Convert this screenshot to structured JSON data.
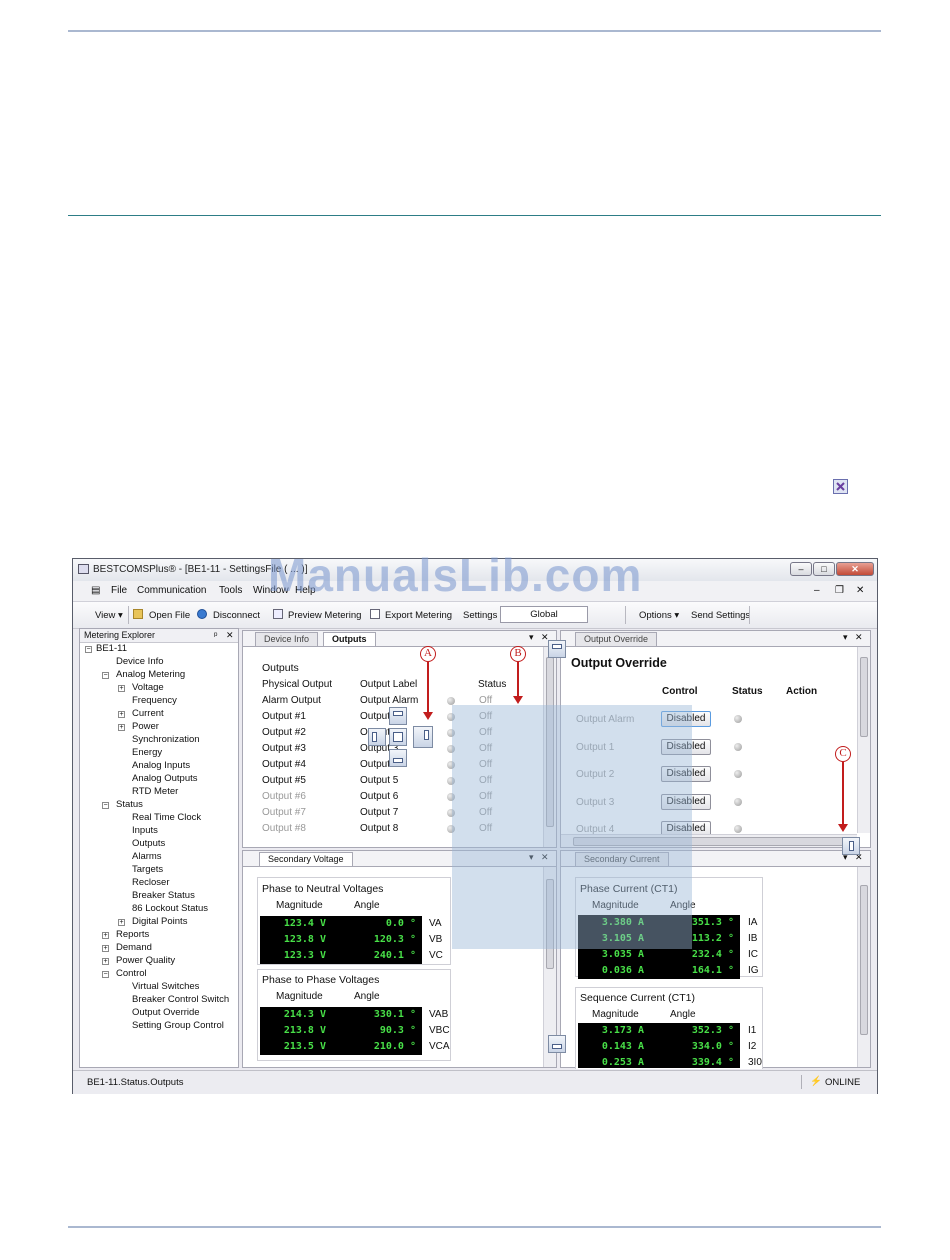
{
  "window": {
    "title": "BESTCOMSPlus® - [BE1-11 - SettingsFile",
    "title_partial": "( ... )]"
  },
  "menu": [
    "File",
    "Communication",
    "Tools",
    "Window",
    "Help"
  ],
  "toolbar": {
    "view": "View",
    "open_file": "Open File",
    "disconnect": "Disconnect",
    "preview_metering": "Preview Metering",
    "export_metering": "Export Metering",
    "settings": "Settings",
    "settings_value": "Global",
    "options": "Options",
    "send_settings": "Send Settings"
  },
  "explorer": {
    "title": "Metering Explorer",
    "tree": {
      "root": "BE1-11",
      "device_info": "Device Info",
      "analog_metering": "Analog Metering",
      "voltage": "Voltage",
      "frequency": "Frequency",
      "current": "Current",
      "power": "Power",
      "synchronization": "Synchronization",
      "energy": "Energy",
      "analog_inputs": "Analog Inputs",
      "analog_outputs": "Analog Outputs",
      "rtd_meter": "RTD Meter",
      "status": "Status",
      "real_time_clock": "Real Time Clock",
      "inputs": "Inputs",
      "outputs": "Outputs",
      "alarms": "Alarms",
      "targets": "Targets",
      "recloser": "Recloser",
      "breaker_status": "Breaker Status",
      "lockout_status": "86 Lockout Status",
      "digital_points": "Digital Points",
      "reports": "Reports",
      "demand": "Demand",
      "power_quality": "Power Quality",
      "control": "Control",
      "virtual_switches": "Virtual Switches",
      "breaker_control_switch": "Breaker Control Switch",
      "output_override": "Output Override",
      "setting_group_control": "Setting Group Control"
    }
  },
  "outputs_pane": {
    "tabs": [
      "Device Info",
      "Outputs"
    ],
    "group_title": "Outputs",
    "col_physical": "Physical Output",
    "col_label": "Output Label",
    "col_status": "Status",
    "rows": [
      {
        "physical": "Alarm Output",
        "label": "Output Alarm",
        "status": "Off"
      },
      {
        "physical": "Output #1",
        "label": "Output 1",
        "status": "Off"
      },
      {
        "physical": "Output #2",
        "label": "Output 2",
        "status": "Off"
      },
      {
        "physical": "Output #3",
        "label": "Output 3",
        "status": "Off"
      },
      {
        "physical": "Output #4",
        "label": "Output 4",
        "status": "Off"
      },
      {
        "physical": "Output #5",
        "label": "Output 5",
        "status": "Off"
      },
      {
        "physical": "Output #6",
        "label": "Output 6",
        "status": "Off"
      },
      {
        "physical": "Output #7",
        "label": "Output 7",
        "status": "Off"
      },
      {
        "physical": "Output #8",
        "label": "Output 8",
        "status": "Off"
      }
    ]
  },
  "override_pane": {
    "tab": "Output Override",
    "title": "Output Override",
    "col_control": "Control",
    "col_status": "Status",
    "col_action": "Action",
    "rows": [
      {
        "label": "Output Alarm",
        "control": "Disabled"
      },
      {
        "label": "Output 1",
        "control": "Disabled"
      },
      {
        "label": "Output 2",
        "control": "Disabled"
      },
      {
        "label": "Output 3",
        "control": "Disabled"
      },
      {
        "label": "Output 4",
        "control": "Disabled"
      }
    ]
  },
  "secondary_voltage": {
    "tab": "Secondary Voltage",
    "ln_title": "Phase to Neutral Voltages",
    "ll_title": "Phase to Phase Voltages",
    "col_mag": "Magnitude",
    "col_angle": "Angle",
    "ln_rows": [
      {
        "mag": "123.4 V",
        "angle": "0.0 °",
        "name": "VA"
      },
      {
        "mag": "123.8 V",
        "angle": "120.3 °",
        "name": "VB"
      },
      {
        "mag": "123.3 V",
        "angle": "240.1 °",
        "name": "VC"
      }
    ],
    "ll_rows": [
      {
        "mag": "214.3 V",
        "angle": "330.1 °",
        "name": "VAB"
      },
      {
        "mag": "213.8 V",
        "angle": "90.3 °",
        "name": "VBC"
      },
      {
        "mag": "213.5 V",
        "angle": "210.0 °",
        "name": "VCA"
      }
    ]
  },
  "secondary_current": {
    "tab": "Secondary Current",
    "phase_title": "Phase Current (CT1)",
    "seq_title": "Sequence Current (CT1)",
    "col_mag": "Magnitude",
    "col_angle": "Angle",
    "phase_rows": [
      {
        "mag": "3.380 A",
        "angle": "351.3 °",
        "name": "IA"
      },
      {
        "mag": "3.105 A",
        "angle": "113.2 °",
        "name": "IB"
      },
      {
        "mag": "3.035 A",
        "angle": "232.4 °",
        "name": "IC"
      },
      {
        "mag": "0.036 A",
        "angle": "164.1 °",
        "name": "IG"
      }
    ],
    "seq_rows": [
      {
        "mag": "3.173 A",
        "angle": "352.3 °",
        "name": "I1"
      },
      {
        "mag": "0.143 A",
        "angle": "334.0 °",
        "name": "I2"
      },
      {
        "mag": "0.253 A",
        "angle": "339.4 °",
        "name": "3I0"
      }
    ]
  },
  "statusbar": {
    "path": "BE1-11.Status.Outputs",
    "state": "ONLINE"
  },
  "callouts": {
    "a": "A",
    "b": "B",
    "c": "C"
  },
  "watermark": "ManualsLib.com",
  "colors": {
    "meter_text": "#48e048",
    "callout": "#c21d1d",
    "rule": "#aab8d0",
    "teal_rule": "#2d7d86"
  }
}
